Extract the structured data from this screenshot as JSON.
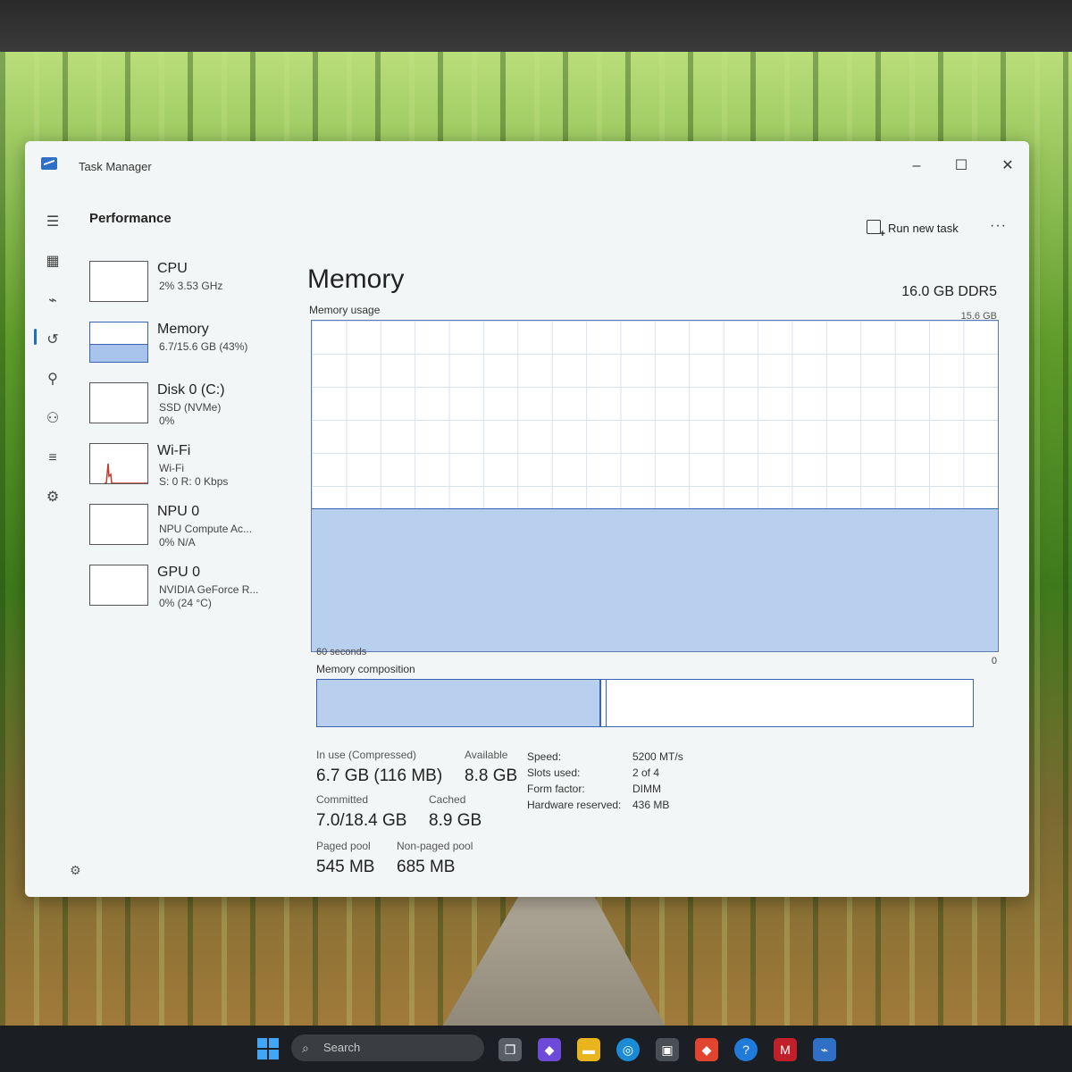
{
  "window": {
    "title": "Task Manager",
    "minimize": "–",
    "maximize": "☐",
    "close": "✕"
  },
  "nav": {
    "menu": "☰",
    "processes": "▦",
    "performance": "⌁",
    "history": "↺",
    "startup": "⚲",
    "users": "⚇",
    "details": "≡",
    "services": "⚙"
  },
  "page": {
    "title": "Performance",
    "run_new_task": "Run new task",
    "more": "···"
  },
  "devices": [
    {
      "name": "CPU",
      "sub1": "2% 3.53 GHz",
      "sub2": ""
    },
    {
      "name": "Memory",
      "sub1": "6.7/15.6 GB (43%)",
      "sub2": ""
    },
    {
      "name": "Disk 0 (C:)",
      "sub1": "SSD (NVMe)",
      "sub2": "0%"
    },
    {
      "name": "Wi-Fi",
      "sub1": "Wi-Fi",
      "sub2": "S: 0 R: 0 Kbps"
    },
    {
      "name": "NPU 0",
      "sub1": "NPU Compute Ac...",
      "sub2": "0% N/A"
    },
    {
      "name": "GPU 0",
      "sub1": "NVIDIA GeForce R...",
      "sub2": "0% (24 °C)"
    }
  ],
  "memory": {
    "title": "Memory",
    "spec": "16.0 GB DDR5",
    "usage_label": "Memory usage",
    "max_label": "15.6 GB",
    "time_label": "60 seconds",
    "zero_label": "0",
    "composition_label": "Memory composition",
    "usage_fraction": 0.43,
    "in_use_label": "In use (Compressed)",
    "in_use_value": "6.7 GB (116 MB)",
    "available_label": "Available",
    "available_value": "8.8 GB",
    "committed_label": "Committed",
    "committed_value": "7.0/18.4 GB",
    "cached_label": "Cached",
    "cached_value": "8.9 GB",
    "paged_label": "Paged pool",
    "paged_value": "545 MB",
    "nonpaged_label": "Non-paged pool",
    "nonpaged_value": "685 MB",
    "details": [
      {
        "k": "Speed:",
        "v": "5200 MT/s"
      },
      {
        "k": "Slots used:",
        "v": "2 of 4"
      },
      {
        "k": "Form factor:",
        "v": "DIMM"
      },
      {
        "k": "Hardware reserved:",
        "v": "436 MB"
      }
    ]
  },
  "taskbar": {
    "search_placeholder": "Search",
    "search_icon": "search-icon"
  },
  "colors": {
    "accent": "#3a63b4",
    "fill": "#b9cfee",
    "wifi": "#c0392b"
  }
}
